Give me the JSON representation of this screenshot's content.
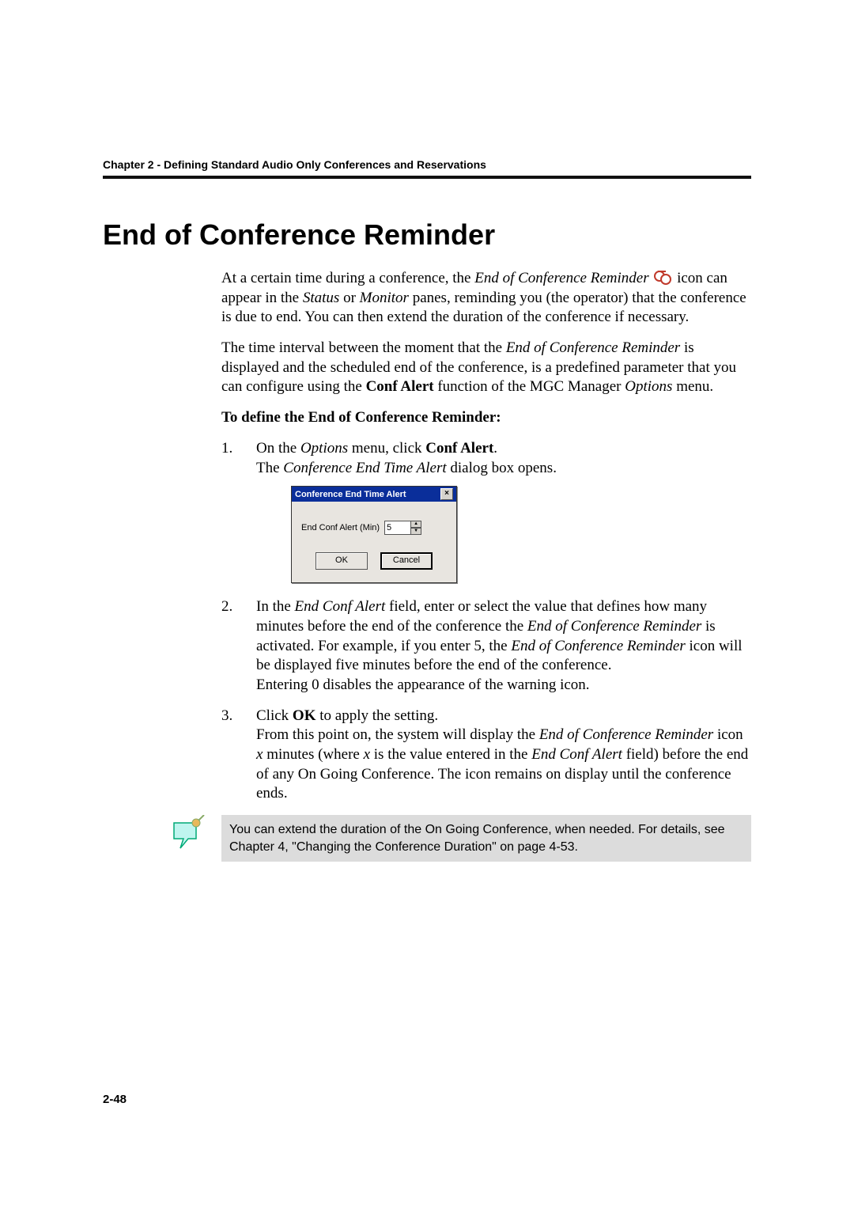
{
  "chapter_header": "Chapter 2 - Defining Standard Audio Only Conferences and Reservations",
  "title": "End of Conference Reminder",
  "intro_preicon": "At a certain time during a conference, the ",
  "intro_endterm": "End of Conference Reminder",
  "intro_posticon": " icon can appear in the ",
  "intro_status": "Status",
  "intro_or": " or ",
  "intro_monitor": "Monitor",
  "intro_rest": " panes, reminding you (the operator) that the conference is due to end. You can then extend the duration of the conference if necessary.",
  "para2_a": "The time interval between the moment that the ",
  "para2_b": "End of Conference Reminder",
  "para2_c": " is displayed and the scheduled end of the conference, is a predefined parameter that you can configure using the ",
  "para2_d": "Conf Alert",
  "para2_e": " function of the MGC Manager ",
  "para2_f": "Options",
  "para2_g": " menu.",
  "subhead": "To define the End of Conference Reminder:",
  "steps": {
    "s1_a": "On the ",
    "s1_b": "Options",
    "s1_c": " menu, click ",
    "s1_d": "Conf Alert",
    "s1_e": ".",
    "s1_open_a": "The ",
    "s1_open_b": "Conference End Time Alert",
    "s1_open_c": " dialog box opens.",
    "s2_a": "In the ",
    "s2_b": "End Conf Alert",
    "s2_c": " field, enter or select the value that defines how many minutes before the end of the conference the ",
    "s2_d": "End of Conference Reminder",
    "s2_e": " is activated. For example, if you enter 5, the ",
    "s2_f": "End of Conference Reminder",
    "s2_g": " icon will be displayed five minutes before the end of the conference.",
    "s2_zero": "Entering 0 disables the appearance of the warning icon.",
    "s3_a": "Click ",
    "s3_b": "OK",
    "s3_c": " to apply the setting.",
    "s3_from_a": "From this point on, the system will display the ",
    "s3_from_b": "End of Conference Reminder",
    "s3_from_c": " icon ",
    "s3_from_d": "x",
    "s3_from_e": " minutes (where ",
    "s3_from_f": "x",
    "s3_from_g": " is the value entered in the ",
    "s3_from_h": "End Conf Alert",
    "s3_from_i": " field) before the end of any On Going Conference. The icon remains on display until the conference ends."
  },
  "dialog": {
    "title": "Conference End Time Alert",
    "field_label": "End Conf Alert (Min)",
    "value": "5",
    "ok": "OK",
    "cancel": "Cancel"
  },
  "note": "You can extend the duration of the On Going Conference, when needed. For details, see Chapter 4, \"Changing the Conference Duration\" on page 4-53.",
  "page_number": "2-48"
}
